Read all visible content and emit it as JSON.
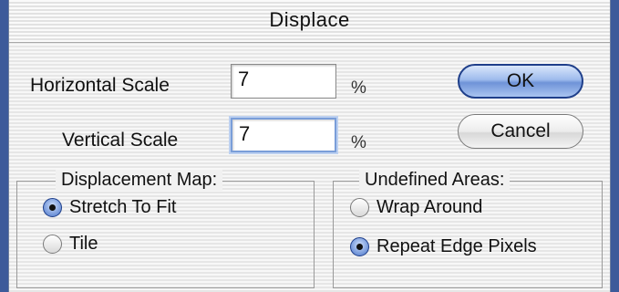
{
  "dialog": {
    "title": "Displace"
  },
  "horizontal_scale": {
    "label": "Horizontal Scale",
    "value": "7",
    "unit": "%"
  },
  "vertical_scale": {
    "label": "Vertical Scale",
    "value": "7",
    "unit": "%"
  },
  "buttons": {
    "ok": "OK",
    "cancel": "Cancel"
  },
  "displacement_map": {
    "legend": "Displacement Map:",
    "options": [
      {
        "label": "Stretch To Fit",
        "selected": true
      },
      {
        "label": "Tile",
        "selected": false
      }
    ]
  },
  "undefined_areas": {
    "legend": "Undefined Areas:",
    "options": [
      {
        "label": "Wrap Around",
        "selected": false
      },
      {
        "label": "Repeat Edge Pixels",
        "selected": true
      }
    ]
  },
  "colors": {
    "accent": "#6f93d8",
    "window_edge": "#3d5a9a"
  }
}
